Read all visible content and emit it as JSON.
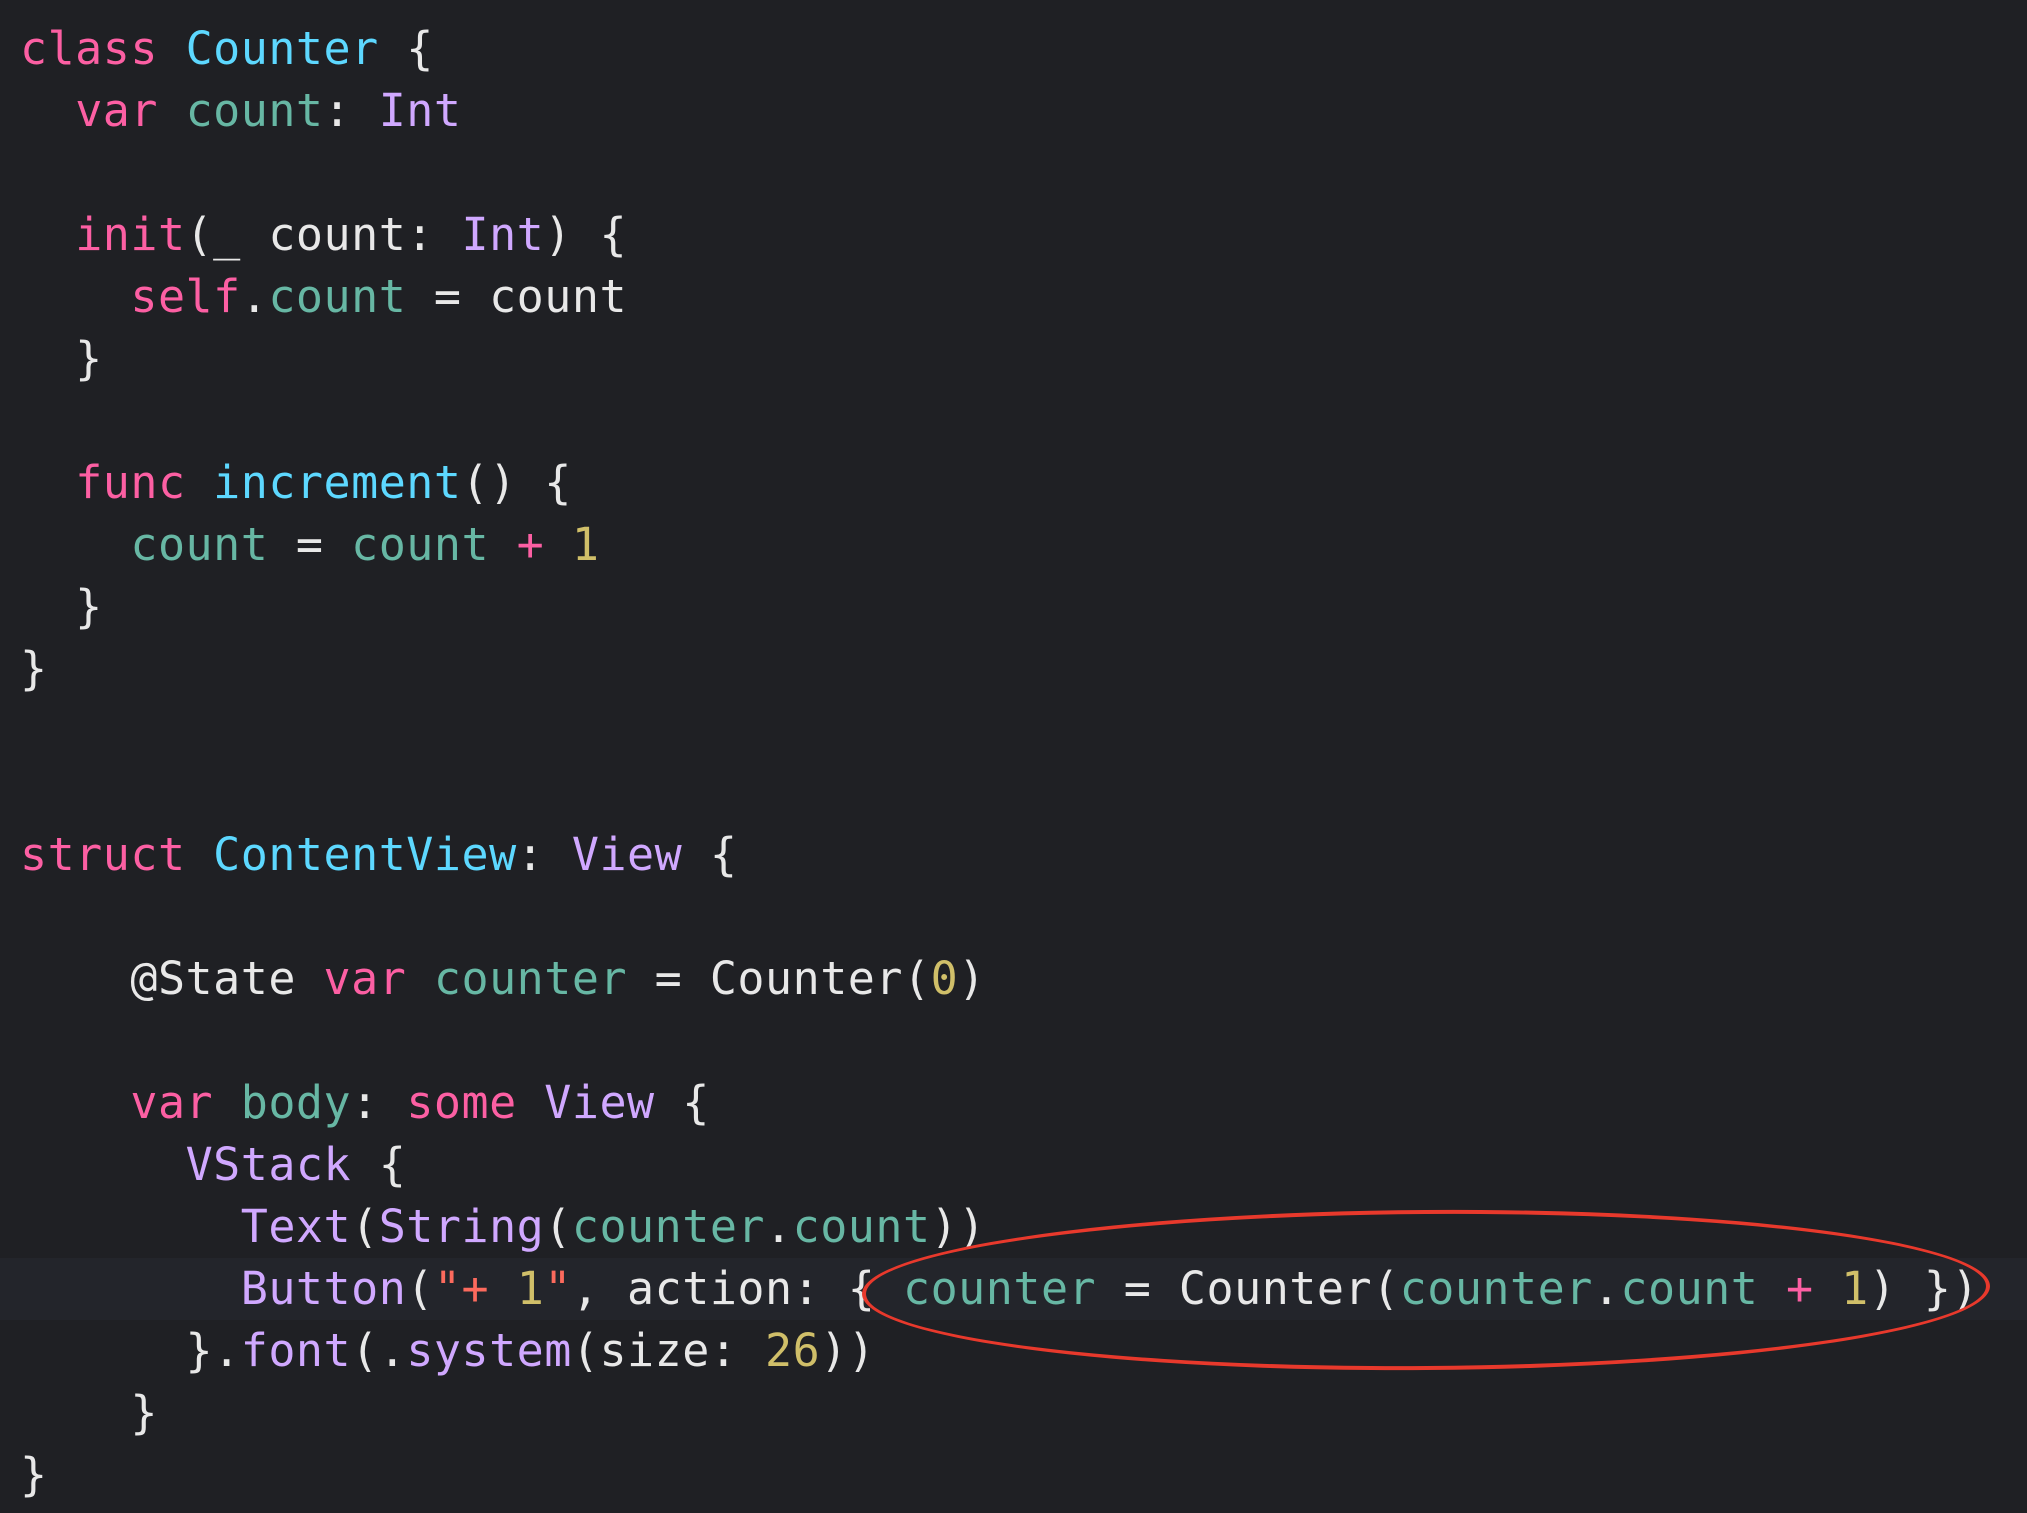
{
  "colors": {
    "background": "#1f2024",
    "keyword": "#fc5fa3",
    "type": "#d0a8ff",
    "class_name": "#5dd8ff",
    "property": "#67b7a4",
    "function": "#67b7a4",
    "plain": "#e8e8e8",
    "number": "#d0bf69",
    "string": "#fc6a5d",
    "annotation_circle": "#e8392c"
  },
  "code": {
    "lines": [
      {
        "text": "",
        "tokens": [
          {
            "t": "class",
            "c": "keyword"
          },
          {
            "t": " ",
            "c": "plain"
          },
          {
            "t": "Counter",
            "c": "class_name"
          },
          {
            "t": " {",
            "c": "plain"
          }
        ]
      },
      {
        "text": "",
        "tokens": [
          {
            "t": "  ",
            "c": "plain"
          },
          {
            "t": "var",
            "c": "keyword"
          },
          {
            "t": " ",
            "c": "plain"
          },
          {
            "t": "count",
            "c": "property"
          },
          {
            "t": ": ",
            "c": "plain"
          },
          {
            "t": "Int",
            "c": "type"
          }
        ]
      },
      {
        "text": "",
        "tokens": []
      },
      {
        "text": "",
        "tokens": [
          {
            "t": "  ",
            "c": "plain"
          },
          {
            "t": "init",
            "c": "keyword"
          },
          {
            "t": "(_ count: ",
            "c": "plain"
          },
          {
            "t": "Int",
            "c": "type"
          },
          {
            "t": ") {",
            "c": "plain"
          }
        ]
      },
      {
        "text": "",
        "tokens": [
          {
            "t": "    ",
            "c": "plain"
          },
          {
            "t": "self",
            "c": "keyword"
          },
          {
            "t": ".",
            "c": "plain"
          },
          {
            "t": "count",
            "c": "property"
          },
          {
            "t": " = count",
            "c": "plain"
          }
        ]
      },
      {
        "text": "",
        "tokens": [
          {
            "t": "  }",
            "c": "plain"
          }
        ]
      },
      {
        "text": "",
        "tokens": []
      },
      {
        "text": "",
        "tokens": [
          {
            "t": "  ",
            "c": "plain"
          },
          {
            "t": "func",
            "c": "keyword"
          },
          {
            "t": " ",
            "c": "plain"
          },
          {
            "t": "increment",
            "c": "class_name"
          },
          {
            "t": "() {",
            "c": "plain"
          }
        ]
      },
      {
        "text": "",
        "tokens": [
          {
            "t": "    ",
            "c": "plain"
          },
          {
            "t": "count",
            "c": "property"
          },
          {
            "t": " = ",
            "c": "plain"
          },
          {
            "t": "count",
            "c": "property"
          },
          {
            "t": " + ",
            "c": "keyword"
          },
          {
            "t": "1",
            "c": "number"
          }
        ]
      },
      {
        "text": "",
        "tokens": [
          {
            "t": "  }",
            "c": "plain"
          }
        ]
      },
      {
        "text": "",
        "tokens": [
          {
            "t": "}",
            "c": "plain"
          }
        ]
      },
      {
        "text": "",
        "tokens": []
      },
      {
        "text": "",
        "tokens": []
      },
      {
        "text": "",
        "tokens": [
          {
            "t": "struct",
            "c": "keyword"
          },
          {
            "t": " ",
            "c": "plain"
          },
          {
            "t": "ContentView",
            "c": "class_name"
          },
          {
            "t": ": ",
            "c": "plain"
          },
          {
            "t": "View",
            "c": "type"
          },
          {
            "t": " {",
            "c": "plain"
          }
        ]
      },
      {
        "text": "",
        "tokens": []
      },
      {
        "text": "",
        "tokens": [
          {
            "t": "    @State ",
            "c": "plain"
          },
          {
            "t": "var",
            "c": "keyword"
          },
          {
            "t": " ",
            "c": "plain"
          },
          {
            "t": "counter",
            "c": "property"
          },
          {
            "t": " = Counter(",
            "c": "plain"
          },
          {
            "t": "0",
            "c": "number"
          },
          {
            "t": ")",
            "c": "plain"
          }
        ]
      },
      {
        "text": "",
        "tokens": []
      },
      {
        "text": "",
        "tokens": [
          {
            "t": "    ",
            "c": "plain"
          },
          {
            "t": "var",
            "c": "keyword"
          },
          {
            "t": " ",
            "c": "plain"
          },
          {
            "t": "body",
            "c": "property"
          },
          {
            "t": ": ",
            "c": "plain"
          },
          {
            "t": "some",
            "c": "keyword"
          },
          {
            "t": " ",
            "c": "plain"
          },
          {
            "t": "View",
            "c": "type"
          },
          {
            "t": " {",
            "c": "plain"
          }
        ]
      },
      {
        "text": "",
        "tokens": [
          {
            "t": "      ",
            "c": "plain"
          },
          {
            "t": "VStack",
            "c": "type"
          },
          {
            "t": " {",
            "c": "plain"
          }
        ]
      },
      {
        "text": "",
        "tokens": [
          {
            "t": "        ",
            "c": "plain"
          },
          {
            "t": "Text",
            "c": "type"
          },
          {
            "t": "(",
            "c": "plain"
          },
          {
            "t": "String",
            "c": "type"
          },
          {
            "t": "(",
            "c": "plain"
          },
          {
            "t": "counter",
            "c": "property"
          },
          {
            "t": ".",
            "c": "plain"
          },
          {
            "t": "count",
            "c": "property"
          },
          {
            "t": "))",
            "c": "plain"
          }
        ]
      },
      {
        "text": "",
        "tokens": [
          {
            "t": "        ",
            "c": "plain"
          },
          {
            "t": "Button",
            "c": "type"
          },
          {
            "t": "(",
            "c": "plain"
          },
          {
            "t": "\"+ ",
            "c": "string"
          },
          {
            "t": "1",
            "c": "number"
          },
          {
            "t": "\"",
            "c": "string"
          },
          {
            "t": ", action: { ",
            "c": "plain"
          },
          {
            "t": "counter",
            "c": "property"
          },
          {
            "t": " = Counter(",
            "c": "plain"
          },
          {
            "t": "counter",
            "c": "property"
          },
          {
            "t": ".",
            "c": "plain"
          },
          {
            "t": "count",
            "c": "property"
          },
          {
            "t": " + ",
            "c": "keyword"
          },
          {
            "t": "1",
            "c": "number"
          },
          {
            "t": ") })",
            "c": "plain"
          }
        ]
      },
      {
        "text": "",
        "tokens": [
          {
            "t": "      }.",
            "c": "plain"
          },
          {
            "t": "font",
            "c": "type"
          },
          {
            "t": "(.",
            "c": "plain"
          },
          {
            "t": "system",
            "c": "type"
          },
          {
            "t": "(size: ",
            "c": "plain"
          },
          {
            "t": "26",
            "c": "number"
          },
          {
            "t": "))",
            "c": "plain"
          }
        ]
      },
      {
        "text": "",
        "tokens": [
          {
            "t": "    }",
            "c": "plain"
          }
        ]
      },
      {
        "text": "",
        "tokens": [
          {
            "t": "}",
            "c": "plain"
          }
        ]
      }
    ],
    "highlighted_line": 20,
    "annotated_snippet": "counter = Counter(counter.count + 1) })"
  }
}
